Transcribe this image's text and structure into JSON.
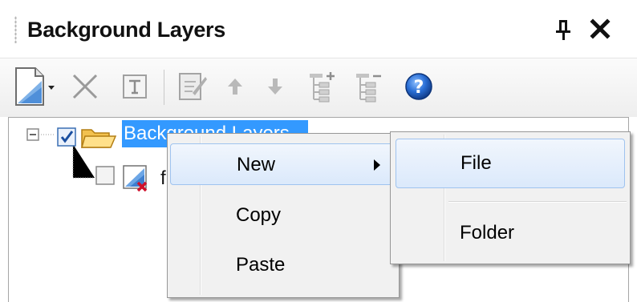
{
  "panel": {
    "title": "Background Layers",
    "pin_icon": "pin-icon",
    "close_icon": "close-icon"
  },
  "toolbar": {
    "items": [
      {
        "icon": "new-document-icon",
        "enabled": true
      },
      {
        "icon": "delete-icon",
        "enabled": false
      },
      {
        "icon": "rename-icon",
        "enabled": false
      },
      {
        "icon": "edit-icon",
        "enabled": false
      },
      {
        "icon": "move-up-icon",
        "enabled": false
      },
      {
        "icon": "move-down-icon",
        "enabled": false
      },
      {
        "icon": "add-child-icon",
        "enabled": false
      },
      {
        "icon": "remove-child-icon",
        "enabled": false
      },
      {
        "icon": "help-icon",
        "enabled": true
      }
    ]
  },
  "tree": {
    "root_label": "Background Layers",
    "root_checked": true,
    "child_label": "f",
    "child_checked": false
  },
  "context_menu": {
    "items": [
      {
        "label": "New",
        "has_submenu": true,
        "highlighted": true
      },
      {
        "label": "Copy",
        "has_submenu": false,
        "highlighted": false
      },
      {
        "label": "Paste",
        "has_submenu": false,
        "highlighted": false
      }
    ]
  },
  "submenu": {
    "items": [
      {
        "label": "File",
        "highlighted": true
      },
      {
        "label": "Folder",
        "highlighted": false
      }
    ]
  },
  "colors": {
    "selection": "#3399ff",
    "menu_highlight_border": "#9fc3ef",
    "help_blue": "#1e63c8"
  }
}
